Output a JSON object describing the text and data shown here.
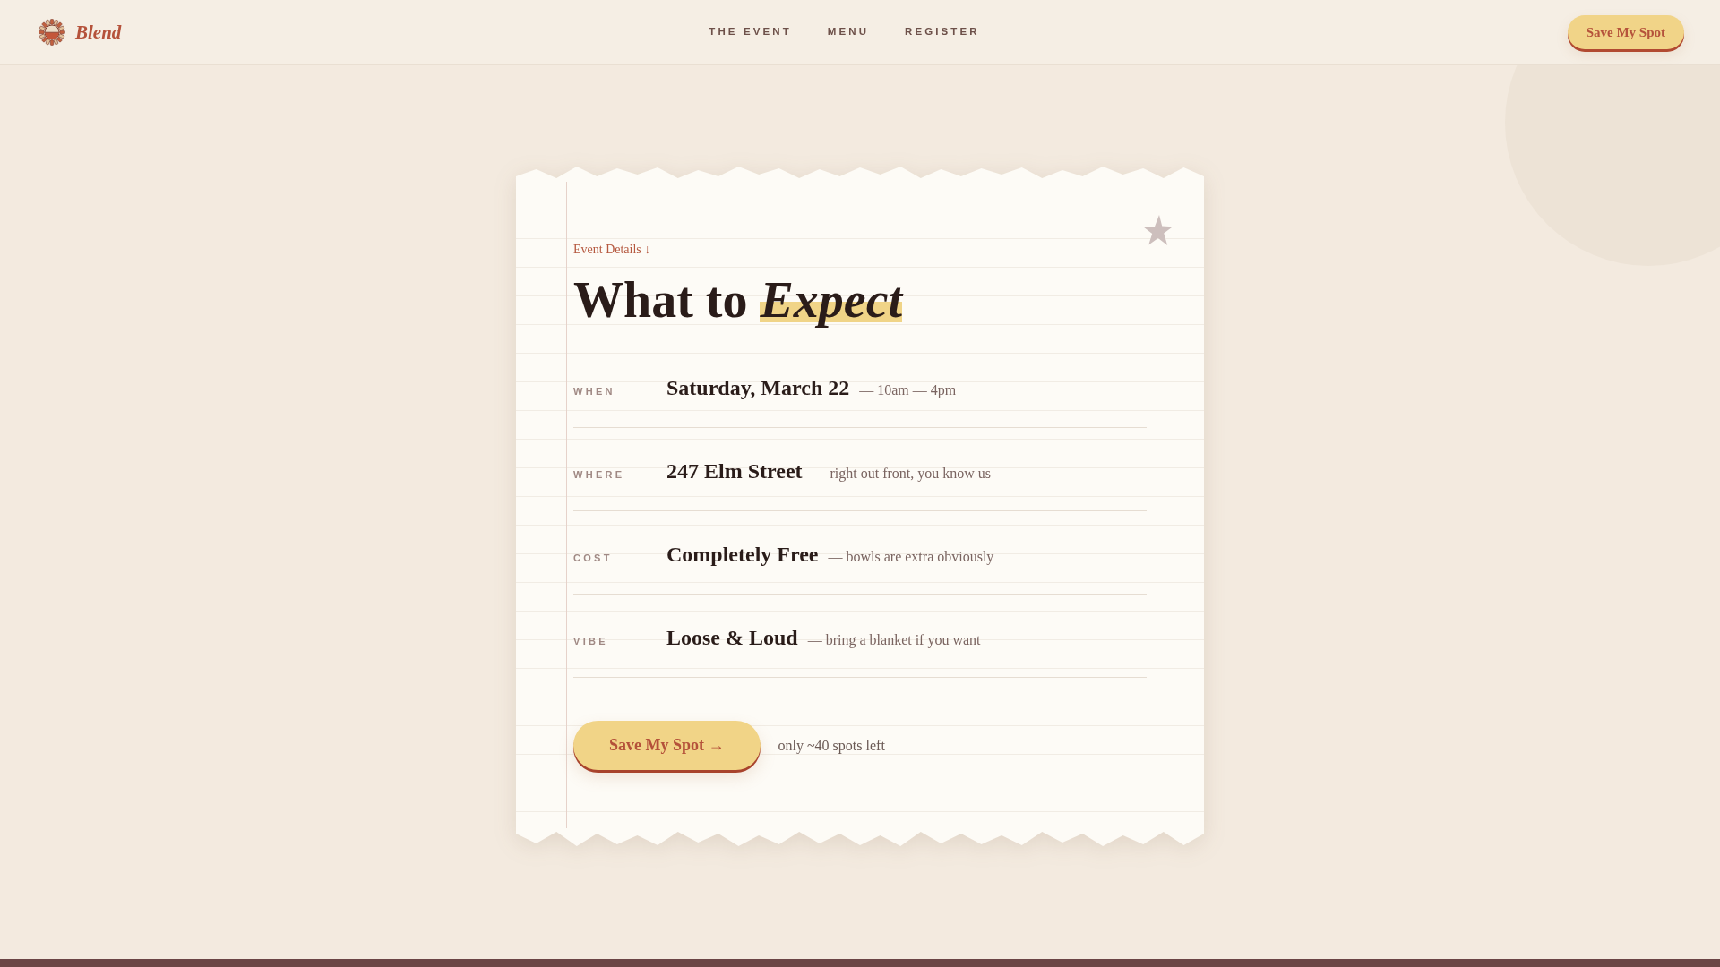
{
  "header": {
    "logo": {
      "name": "Blend"
    },
    "nav": [
      {
        "label": "THE EVENT"
      },
      {
        "label": "MENU"
      },
      {
        "label": "REGISTER"
      }
    ],
    "cta": "Save My Spot"
  },
  "card": {
    "kicker": "Event Details ↓",
    "title": "What to *Expect*",
    "details": [
      {
        "label": "WHEN",
        "value": "Saturday, March 22",
        "note": "— 10am — 4pm"
      },
      {
        "label": "WHERE",
        "value": "247 Elm Street",
        "note": "— right out front, you know us"
      },
      {
        "label": "COST",
        "value": "Completely Free",
        "note": "— bowls are extra obviously"
      },
      {
        "label": "VIBE",
        "value": "Loose & Loud",
        "note": "— bring a blanket if you want"
      }
    ],
    "cta": "Save My Spot →",
    "note": "only ~40 spots left"
  }
}
